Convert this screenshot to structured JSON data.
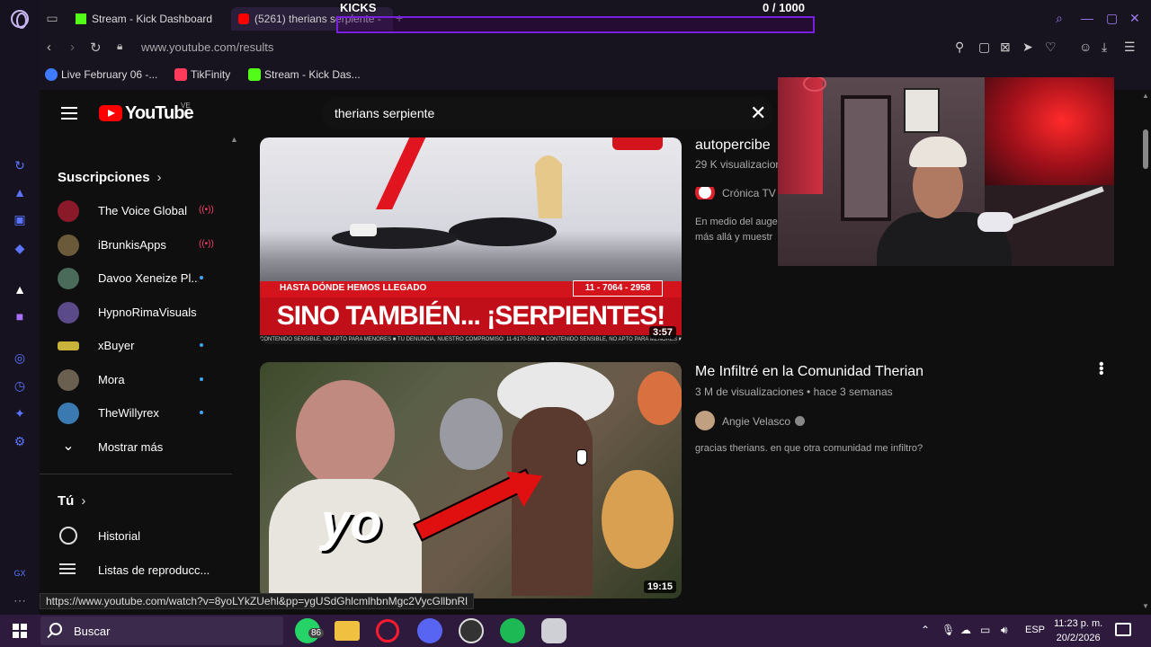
{
  "browser": {
    "tabs": [
      {
        "label": "Stream - Kick Dashboard",
        "color": "#53fc18"
      },
      {
        "label": "(5261) therians serpiente -",
        "color": "#ff0000"
      }
    ],
    "url": "www.youtube.com/results",
    "bookmarks": [
      {
        "label": "Live February 06 -...",
        "color": "#3e7bff"
      },
      {
        "label": "TikFinity",
        "color": "#ff3b5c"
      },
      {
        "label": "Stream - Kick Das...",
        "color": "#53fc18"
      }
    ]
  },
  "kicks_overlay": {
    "title": "KICKS",
    "count": "0 / 1000",
    "progress": 0
  },
  "youtube": {
    "logo_text": "YouTube",
    "country_code": "VE",
    "search_value": "therians serpiente",
    "sidebar": {
      "subscriptions_heading": "Suscripciones",
      "subscriptions": [
        {
          "name": "The Voice Global",
          "status": "live",
          "color": "#8a1a2a"
        },
        {
          "name": "iBrunkisApps",
          "status": "live",
          "color": "#6b5a3a"
        },
        {
          "name": "Davoo Xeneize Pl...",
          "status": "new",
          "color": "#4a6a5a"
        },
        {
          "name": "HypnoRimaVisuals",
          "status": "",
          "color": "#5a4a8a"
        },
        {
          "name": "xBuyer",
          "status": "new",
          "color": "#c9b23a"
        },
        {
          "name": "Mora",
          "status": "new",
          "color": "#6a6050"
        },
        {
          "name": "TheWillyrex",
          "status": "new",
          "color": "#3a7ab0"
        }
      ],
      "show_more": "Mostrar más",
      "you_heading": "Tú",
      "history": "Historial",
      "playlists": "Listas de reproducc..."
    },
    "results": [
      {
        "title": "autopercibe",
        "views": "29 K visualizacion",
        "channel": "Crónica TV",
        "description_line1": "En medio del auge",
        "description_line2": "más allá y muestr",
        "duration": "3:57",
        "thumb_banner_small": "HASTA DÓNDE HEMOS LLEGADO",
        "thumb_phone": "11 - 7064 - 2958",
        "thumb_banner_big": "SINO TAMBIÉN... ¡SERPIENTES!",
        "thumb_ticker": "CONTENIDO SENSIBLE, NO APTO PARA MENORES ■ TU DENUNCIA, NUESTRO COMPROMISO: 11-6170-5092 ■ CONTENIDO SENSIBLE, NO APTO PARA MENORES ■ TU DENUNCIA, NUESTRO COMPROMISO"
      },
      {
        "title": "Me Infiltré en la Comunidad Therian",
        "views": "3 M de visualizaciones • hace 3 semanas",
        "channel": "Angie Velasco",
        "description_line1": "gracias therians. en que otra comunidad me infiltro?",
        "duration": "19:15",
        "thumb_text": "yo"
      }
    ]
  },
  "status_url": "https://www.youtube.com/watch?v=8yoLYkZUehl&pp=ygUSdGhlcmlhbnMgc2VycGllbnRl",
  "taskbar": {
    "search_label": "Buscar",
    "whatsapp_badge": "86",
    "language": "ESP",
    "time": "11:23 p. m.",
    "date": "20/2/2026"
  }
}
